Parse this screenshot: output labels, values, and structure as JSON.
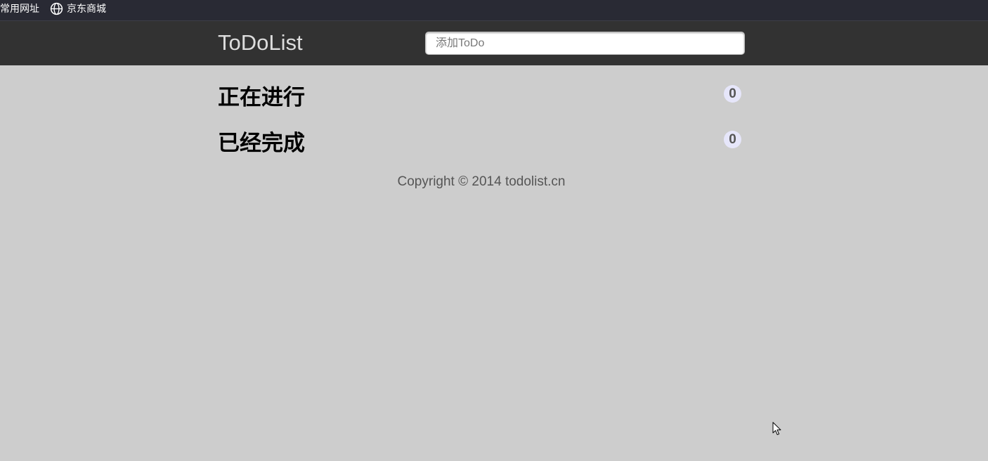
{
  "bookmarks": {
    "folder_label": "常用网址",
    "items": [
      {
        "label": "京东商城",
        "icon": "globe-icon"
      }
    ]
  },
  "header": {
    "brand": "ToDoList",
    "input_placeholder": "添加ToDo",
    "input_value": ""
  },
  "sections": [
    {
      "title": "正在进行",
      "count": "0"
    },
    {
      "title": "已经完成",
      "count": "0"
    }
  ],
  "footer": {
    "copyright": "Copyright © 2014 ",
    "link": "todolist.cn"
  },
  "colors": {
    "bookmarks_bg": "#292a34",
    "header_bg": "#323232",
    "page_bg": "#cdcdcd",
    "badge_bg": "#e6e6fa",
    "badge_text": "#555555"
  }
}
